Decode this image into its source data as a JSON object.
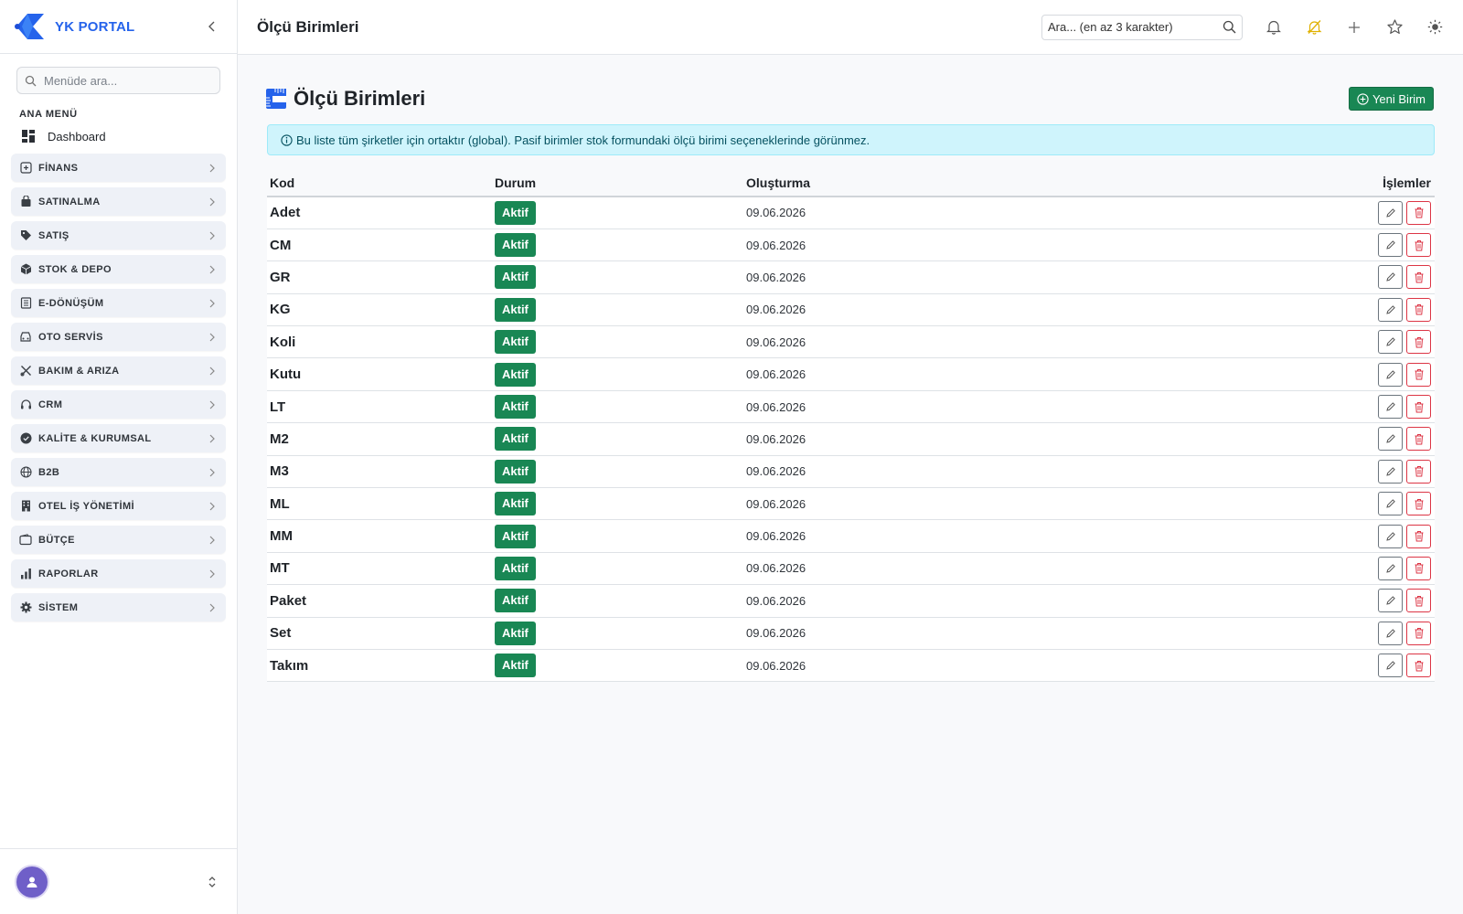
{
  "brand": {
    "title": "YK PORTAL"
  },
  "sidebar": {
    "search_placeholder": "Menüde ara...",
    "section_label": "ANA MENÜ",
    "dashboard_label": "Dashboard",
    "items": [
      {
        "label": "FİNANS",
        "icon": "finance-icon"
      },
      {
        "label": "SATINALMA",
        "icon": "shopping-bag-icon"
      },
      {
        "label": "SATIŞ",
        "icon": "tag-icon"
      },
      {
        "label": "STOK & DEPO",
        "icon": "box-icon"
      },
      {
        "label": "E-DÖNÜŞÜM",
        "icon": "document-icon"
      },
      {
        "label": "OTO SERVİS",
        "icon": "car-icon"
      },
      {
        "label": "BAKIM & ARIZA",
        "icon": "tools-icon"
      },
      {
        "label": "CRM",
        "icon": "headset-icon"
      },
      {
        "label": "KALİTE & KURUMSAL",
        "icon": "patch-check-icon"
      },
      {
        "label": "B2B",
        "icon": "globe-icon"
      },
      {
        "label": "OTEL İŞ YÖNETİMİ",
        "icon": "building-icon"
      },
      {
        "label": "BÜTÇE",
        "icon": "wallet-icon"
      },
      {
        "label": "RAPORLAR",
        "icon": "bar-chart-icon"
      },
      {
        "label": "SİSTEM",
        "icon": "gear-icon"
      }
    ]
  },
  "header": {
    "title": "Ölçü Birimleri",
    "search_placeholder": "Ara... (en az 3 karakter)"
  },
  "page": {
    "title": "Ölçü Birimleri",
    "new_button_label": "Yeni Birim",
    "info_text": "Bu liste tüm şirketler için ortaktır (global). Pasif birimler stok formundaki ölçü birimi seçeneklerinde görünmez."
  },
  "table": {
    "columns": {
      "kod": "Kod",
      "durum": "Durum",
      "olusturma": "Oluşturma",
      "islemler": "İşlemler"
    },
    "rows": [
      {
        "kod": "Adet",
        "durum": "Aktif",
        "olusturma": "09.06.2026"
      },
      {
        "kod": "CM",
        "durum": "Aktif",
        "olusturma": "09.06.2026"
      },
      {
        "kod": "GR",
        "durum": "Aktif",
        "olusturma": "09.06.2026"
      },
      {
        "kod": "KG",
        "durum": "Aktif",
        "olusturma": "09.06.2026"
      },
      {
        "kod": "Koli",
        "durum": "Aktif",
        "olusturma": "09.06.2026"
      },
      {
        "kod": "Kutu",
        "durum": "Aktif",
        "olusturma": "09.06.2026"
      },
      {
        "kod": "LT",
        "durum": "Aktif",
        "olusturma": "09.06.2026"
      },
      {
        "kod": "M2",
        "durum": "Aktif",
        "olusturma": "09.06.2026"
      },
      {
        "kod": "M3",
        "durum": "Aktif",
        "olusturma": "09.06.2026"
      },
      {
        "kod": "ML",
        "durum": "Aktif",
        "olusturma": "09.06.2026"
      },
      {
        "kod": "MM",
        "durum": "Aktif",
        "olusturma": "09.06.2026"
      },
      {
        "kod": "MT",
        "durum": "Aktif",
        "olusturma": "09.06.2026"
      },
      {
        "kod": "Paket",
        "durum": "Aktif",
        "olusturma": "09.06.2026"
      },
      {
        "kod": "Set",
        "durum": "Aktif",
        "olusturma": "09.06.2026"
      },
      {
        "kod": "Takım",
        "durum": "Aktif",
        "olusturma": "09.06.2026"
      }
    ]
  },
  "colors": {
    "brand": "#2563eb",
    "success": "#198754",
    "danger": "#dc3545",
    "info_bg": "#cff4fc",
    "avatar": "#6f5fc8",
    "bell_slash": "#e0b100"
  }
}
